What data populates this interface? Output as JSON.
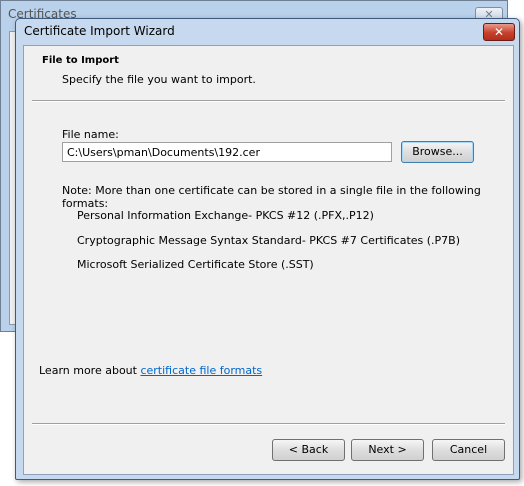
{
  "background_window": {
    "title": "Certificates",
    "close_glyph": "✕"
  },
  "dialog": {
    "title": "Certificate Import Wizard",
    "close_glyph": "✕",
    "header": {
      "title": "File to Import",
      "subtitle": "Specify the file you want to import."
    },
    "file": {
      "label": "File name:",
      "value": "C:\\Users\\pman\\Documents\\192.cer",
      "browse_label": "Browse..."
    },
    "note": "Note:  More than one certificate can be stored in a single file in the following formats:",
    "formats": [
      "Personal Information Exchange- PKCS #12 (.PFX,.P12)",
      "Cryptographic Message Syntax Standard- PKCS #7 Certificates (.P7B)",
      "Microsoft Serialized Certificate Store (.SST)"
    ],
    "learn_more": {
      "prefix": "Learn more about ",
      "link": "certificate file formats"
    },
    "buttons": {
      "back": "< Back",
      "next": "Next >",
      "cancel": "Cancel"
    }
  },
  "colors": {
    "link": "#0066cc",
    "close_button": "#c7402c",
    "frame": "#c7d9ee"
  }
}
